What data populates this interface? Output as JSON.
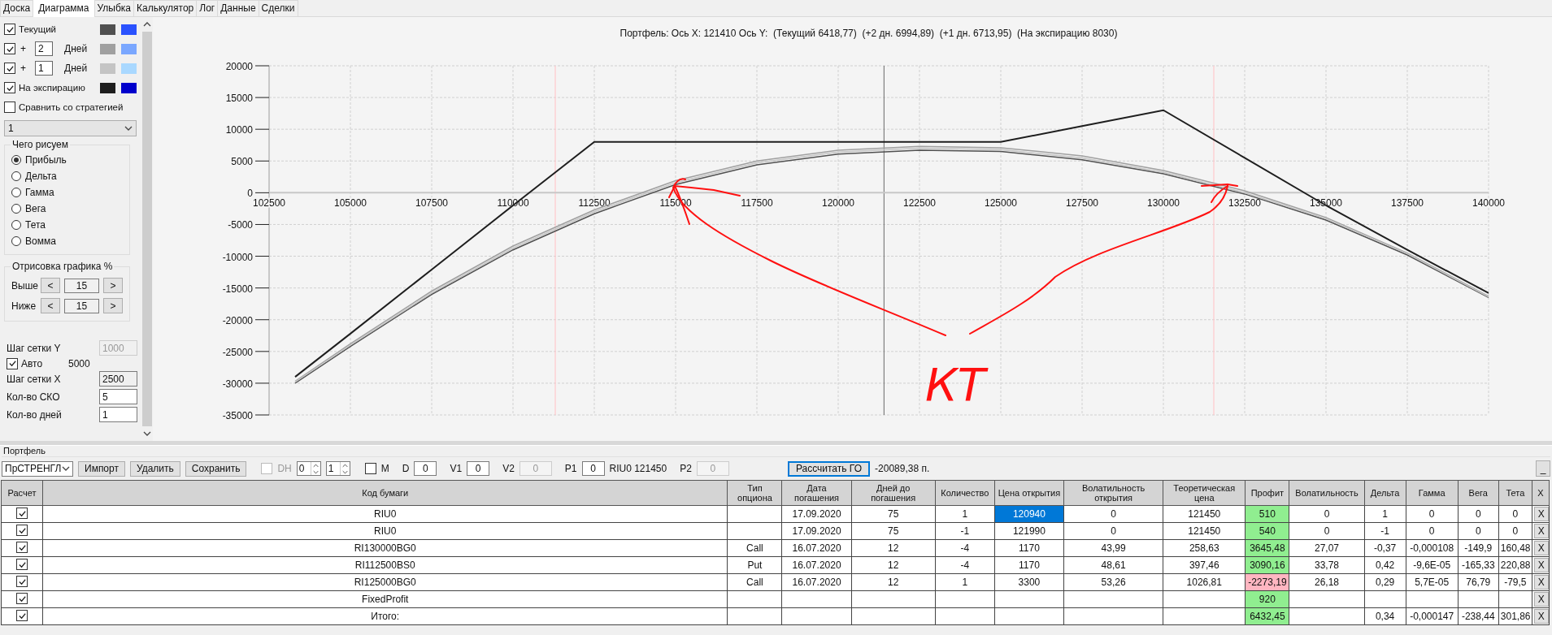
{
  "tabs": [
    {
      "label": "Доска",
      "selected": false
    },
    {
      "label": "Диаграмма",
      "selected": true
    },
    {
      "label": "Улыбка",
      "selected": false
    },
    {
      "label": "Калькулятор",
      "selected": false
    },
    {
      "label": "Лог",
      "selected": false
    },
    {
      "label": "Данные",
      "selected": false
    },
    {
      "label": "Сделки",
      "selected": false
    }
  ],
  "legend_rows": [
    {
      "kind": "plain",
      "checked": true,
      "label": "Текущий",
      "swatches": [
        {
          "color": "#505050"
        },
        {
          "color": "#2a52fe"
        }
      ]
    },
    {
      "kind": "days",
      "checked": true,
      "prefix": "+",
      "days": "2",
      "unit": "Дней",
      "swatches": [
        {
          "color": "#a0a0a0"
        },
        {
          "color": "#7aa7ff"
        }
      ]
    },
    {
      "kind": "days",
      "checked": true,
      "prefix": "+",
      "days": "1",
      "unit": "Дней",
      "swatches": [
        {
          "color": "#c4c4c4"
        },
        {
          "color": "#a9d8ff"
        }
      ]
    },
    {
      "kind": "plain",
      "checked": true,
      "label": "На экспирацию",
      "swatches": [
        {
          "color": "#1e1e1e"
        },
        {
          "color": "#0000cc"
        }
      ]
    }
  ],
  "compare": {
    "checked": false,
    "label": "Сравнить со стратегией"
  },
  "strategy_select": {
    "value": "1"
  },
  "plot_group": {
    "title": "Чего рисуем",
    "options": [
      {
        "label": "Прибыль",
        "selected": true
      },
      {
        "label": "Дельта",
        "selected": false
      },
      {
        "label": "Гамма",
        "selected": false
      },
      {
        "label": "Вега",
        "selected": false
      },
      {
        "label": "Тета",
        "selected": false
      },
      {
        "label": "Вомма",
        "selected": false
      }
    ]
  },
  "range_group": {
    "title": "Отрисовка графика %",
    "rows": [
      {
        "label": "Выше",
        "dec": "<",
        "value": "15",
        "inc": ">"
      },
      {
        "label": "Ниже",
        "dec": "<",
        "value": "15",
        "inc": ">"
      }
    ]
  },
  "grid_rows": [
    {
      "kind": "field",
      "label": "Шаг сетки Y",
      "value": "1000",
      "disabled": true,
      "readonly": false
    },
    {
      "kind": "check",
      "checked": true,
      "label": "Авто",
      "value": "5000"
    },
    {
      "kind": "field",
      "label": "Шаг сетки X",
      "value": "2500",
      "disabled": false,
      "readonly": true
    },
    {
      "kind": "field",
      "label": "Кол-во СКО",
      "value": "5",
      "disabled": false,
      "readonly": false
    },
    {
      "kind": "field",
      "label": "Кол-во дней",
      "value": "1",
      "disabled": false,
      "readonly": false
    }
  ],
  "chart_title": "Портфель: Ось X: 121410 Ось Y:  (Текущий 6418,77)  (+2 дн. 6994,89)  (+1 дн. 6713,95)  (На экспирацию 8030)",
  "chart": {
    "chart_data": {
      "type": "line",
      "x": [
        103300,
        105000,
        107500,
        110000,
        112500,
        115000,
        117500,
        120000,
        122500,
        125000,
        127500,
        130000,
        132500,
        135000,
        137500,
        140000
      ],
      "xlim": [
        102500,
        140000
      ],
      "ylim": [
        -35000,
        20000
      ],
      "xticks": [
        102500,
        105000,
        107500,
        110000,
        112500,
        115000,
        117500,
        120000,
        122500,
        125000,
        127500,
        130000,
        132500,
        135000,
        137500,
        140000
      ],
      "yticks": [
        -35000,
        -30000,
        -25000,
        -20000,
        -15000,
        -10000,
        -5000,
        0,
        5000,
        10000,
        15000,
        20000
      ],
      "grid": true,
      "series": [
        {
          "color": "#505050",
          "values": [
            -30000,
            -24200,
            -16000,
            -9000,
            -3300,
            1300,
            4400,
            6100,
            6700,
            6500,
            5200,
            3000,
            -200,
            -4300,
            -9800,
            -16500
          ]
        },
        {
          "color": "#a0a0a0",
          "values": [
            -29700,
            -23800,
            -15500,
            -8400,
            -2700,
            1900,
            5000,
            6700,
            7300,
            7100,
            5800,
            3500,
            300,
            -3900,
            -9500,
            -16300
          ]
        },
        {
          "color": "#c4c4c4",
          "values": [
            -29800,
            -24000,
            -15800,
            -8700,
            -3000,
            1600,
            4700,
            6400,
            7000,
            6800,
            5500,
            3200,
            0,
            -4100,
            -9600,
            -16400
          ]
        },
        {
          "color": "#1e1e1e",
          "values": [
            -29000,
            -22200,
            -12100,
            -2000,
            8000,
            8000,
            8000,
            8000,
            8000,
            8000,
            10500,
            13000,
            5500,
            -2000,
            -9000,
            -15800
          ]
        }
      ],
      "ref_lines": [
        {
          "axis": "x",
          "value": 111300,
          "color": "#ffc8cc"
        },
        {
          "axis": "x",
          "value": 131550,
          "color": "#ffc8cc"
        },
        {
          "axis": "x",
          "value": 121410,
          "color": "#808080"
        }
      ]
    }
  },
  "handwritten_note": {
    "text": "КТ"
  },
  "portfolio": {
    "title": "Портфель",
    "toolbar": [
      {
        "kind": "select",
        "value": "ПрСТРЕНГЛ"
      },
      {
        "kind": "button",
        "label": "Импорт",
        "focused": false
      },
      {
        "kind": "button",
        "label": "Удалить",
        "focused": false
      },
      {
        "kind": "button",
        "label": "Сохранить",
        "focused": false
      },
      {
        "kind": "check",
        "label": "DH",
        "checked": false,
        "disabled": true
      },
      {
        "kind": "spin",
        "value": "0"
      },
      {
        "kind": "spin",
        "value": "1"
      },
      {
        "kind": "check",
        "label": "M",
        "checked": false,
        "disabled": false
      },
      {
        "kind": "field",
        "label": "D",
        "value": "0",
        "disabled": false
      },
      {
        "kind": "field",
        "label": "V1",
        "value": "0",
        "disabled": false
      },
      {
        "kind": "field",
        "label": "V2",
        "value": "0",
        "disabled": true
      },
      {
        "kind": "field",
        "label": "P1",
        "value": "0",
        "disabled": false
      },
      {
        "kind": "text",
        "text": "RIU0 121450"
      },
      {
        "kind": "field",
        "label": "P2",
        "value": "0",
        "disabled": true
      },
      {
        "kind": "button",
        "label": "Рассчитать ГО",
        "focused": true
      },
      {
        "kind": "text",
        "text": "-20089,38 п."
      },
      {
        "kind": "minimize",
        "label": "_"
      }
    ],
    "table": {
      "columns": [
        "Расчет",
        "Код бумаги",
        "Тип опциона",
        "Дата погашения",
        "Дней до погашения",
        "Количество",
        "Цена открытия",
        "Волатильность открытия",
        "Теоретическая цена",
        "Профит",
        "Волатильность",
        "Дельта",
        "Гамма",
        "Вега",
        "Тета",
        "X"
      ],
      "rows": [
        {
          "checked": true,
          "code": "RIU0",
          "expiry": "17.09.2020",
          "days": "75",
          "qty": "1",
          "open_price": "120940",
          "selected": true,
          "open_vol": "0",
          "theo_price": "121450",
          "profit": "510",
          "color": "#90ee90",
          "vol": "0",
          "delta": "1",
          "gamma": "0",
          "vega": "0",
          "theta": "0",
          "delete": "X"
        },
        {
          "checked": true,
          "code": "RIU0",
          "expiry": "17.09.2020",
          "days": "75",
          "qty": "-1",
          "open_price": "121990",
          "selected": false,
          "open_vol": "0",
          "theo_price": "121450",
          "profit": "540",
          "color": "#90ee90",
          "vol": "0",
          "delta": "-1",
          "gamma": "0",
          "vega": "0",
          "theta": "0",
          "delete": "X"
        },
        {
          "checked": true,
          "code": "RI130000BG0",
          "option_type": "Call",
          "expiry": "16.07.2020",
          "days": "12",
          "qty": "-4",
          "open_price": "1170",
          "selected": false,
          "open_vol": "43,99",
          "theo_price": "258,63",
          "profit": "3645,48",
          "color": "#90ee90",
          "vol": "27,07",
          "delta": "-0,37",
          "gamma": "-0,000108",
          "vega": "-149,9",
          "theta": "160,48",
          "delete": "X"
        },
        {
          "checked": true,
          "code": "RI112500BS0",
          "option_type": "Put",
          "expiry": "16.07.2020",
          "days": "12",
          "qty": "-4",
          "open_price": "1170",
          "selected": false,
          "open_vol": "48,61",
          "theo_price": "397,46",
          "profit": "3090,16",
          "color": "#90ee90",
          "vol": "33,78",
          "delta": "0,42",
          "gamma": "-9,6E-05",
          "vega": "-165,33",
          "theta": "220,88",
          "delete": "X"
        },
        {
          "checked": true,
          "code": "RI125000BG0",
          "option_type": "Call",
          "expiry": "16.07.2020",
          "days": "12",
          "qty": "1",
          "open_price": "3300",
          "selected": false,
          "open_vol": "53,26",
          "theo_price": "1026,81",
          "profit": "-2273,19",
          "color": "#ffb6c1",
          "vol": "26,18",
          "delta": "0,29",
          "gamma": "5,7E-05",
          "vega": "76,79",
          "theta": "-79,5",
          "delete": "X"
        },
        {
          "checked": true,
          "code": "FixedProfit",
          "selected": false,
          "profit": "920",
          "color": "#90ee90",
          "delete": "X"
        },
        {
          "checked": true,
          "code": "Итого:",
          "selected": false,
          "profit": "6432,45",
          "color": "#90ee90",
          "delta": "0,34",
          "gamma": "-0,000147",
          "vega": "-238,44",
          "theta": "301,86",
          "delete": "X"
        }
      ]
    }
  }
}
